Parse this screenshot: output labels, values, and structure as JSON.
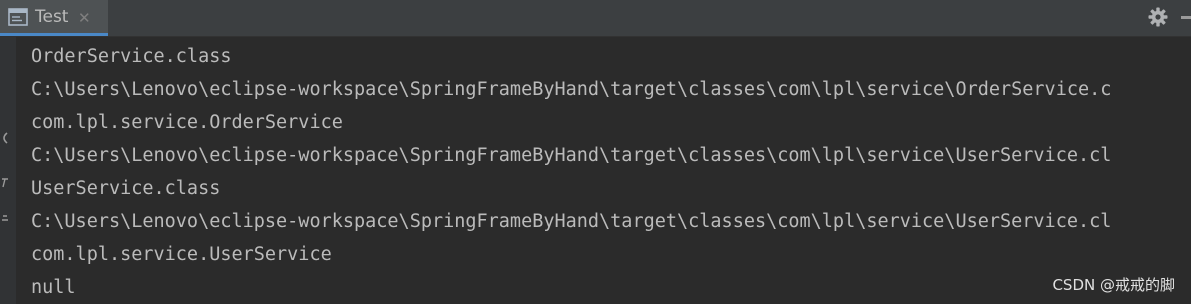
{
  "tab": {
    "title": "Test",
    "close_glyph": "✕",
    "icon": "console-icon"
  },
  "toolbar": {
    "settings_icon": "gear-icon",
    "minimize_icon": "minimize-icon"
  },
  "console": {
    "lines": [
      "OrderService.class",
      "C:\\Users\\Lenovo\\eclipse-workspace\\SpringFrameByHand\\target\\classes\\com\\lpl\\service\\OrderService.c",
      "com.lpl.service.OrderService",
      "C:\\Users\\Lenovo\\eclipse-workspace\\SpringFrameByHand\\target\\classes\\com\\lpl\\service\\UserService.cl",
      "UserService.class",
      "C:\\Users\\Lenovo\\eclipse-workspace\\SpringFrameByHand\\target\\classes\\com\\lpl\\service\\UserService.cl",
      "com.lpl.service.UserService",
      "null"
    ]
  },
  "watermark": "CSDN @戒戒的脚",
  "colors": {
    "background": "#2b2b2b",
    "tab_active": "#4e5254",
    "tab_accent": "#4a88c7",
    "text": "#bbbbbb"
  }
}
